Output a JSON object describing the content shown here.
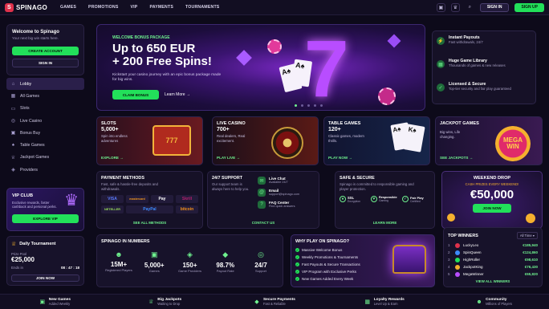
{
  "brand": {
    "name": "SPINAGO"
  },
  "nav": [
    "GAMES",
    "PROMOTIONS",
    "VIP",
    "PAYMENTS",
    "TOURNAMENTS"
  ],
  "topbar": {
    "signin": "SIGN IN",
    "signup": "SIGN UP"
  },
  "welcome": {
    "title": "Welcome to Spinago",
    "subtitle": "Your next big win starts here.",
    "create": "CREATE ACCOUNT",
    "signin": "SIGN IN"
  },
  "menu": [
    "Lobby",
    "All Games",
    "Slots",
    "Live Casino",
    "Bonus Buy",
    "Table Games",
    "Jackpot Games",
    "Providers"
  ],
  "vip": {
    "title": "VIP CLUB",
    "desc": "Exclusive rewards, faster cashback and personal perks.",
    "button": "EXPLORE VIP"
  },
  "tournament": {
    "title": "Daily Tournament",
    "prize_label": "Prize Pool",
    "prize": "€25,000",
    "ends_label": "Ends in",
    "time": "08 : 47 : 18",
    "button": "JOIN NOW"
  },
  "hero": {
    "tag": "WELCOME BONUS PACKAGE",
    "line1": "Up to 650 EUR",
    "line2": "+ 200 Free Spins!",
    "desc": "Kickstart your casino journey with an epic bonus package made for big wins.",
    "claim": "CLAIM BONUS",
    "learn": "Learn More"
  },
  "features": [
    {
      "title": "Instant Payouts",
      "desc": "Fast withdrawals, 24/7"
    },
    {
      "title": "Huge Game Library",
      "desc": "Thousands of games & new releases"
    },
    {
      "title": "Licensed & Secure",
      "desc": "Top-tier security and fair play guaranteed"
    }
  ],
  "categories": [
    {
      "title": "SLOTS",
      "count": "5,000+",
      "desc": "Spin into endless adventures",
      "link": "EXPLORE"
    },
    {
      "title": "LIVE CASINO",
      "count": "700+",
      "desc": "Real dealers, Real excitement.",
      "link": "PLAY LIVE"
    },
    {
      "title": "TABLE GAMES",
      "count": "120+",
      "desc": "Classic games, modern thrills.",
      "link": "PLAY NOW"
    },
    {
      "title": "JACKPOT GAMES",
      "count": "",
      "desc": "Big wins, Life changing.",
      "link": "SEE JACKPOTS",
      "badge1": "MEGA",
      "badge2": "WIN"
    }
  ],
  "payments": {
    "title": "PAYMENT METHODS",
    "desc": "Fast, safe & hassle-free deposits and withdrawals.",
    "methods": [
      "VISA",
      "mastercard",
      "Pay",
      "Skrill",
      "NETELLER",
      "PayPal",
      "bitcoin"
    ],
    "link": "SEE ALL METHODS"
  },
  "support": {
    "title": "24/7 SUPPORT",
    "desc": "Our support team is always here to help you.",
    "items": [
      {
        "t": "Live Chat",
        "s": "Available 24/7"
      },
      {
        "t": "Email",
        "s": "support@spinago.com"
      },
      {
        "t": "FAQ Center",
        "s": "Find quick answers"
      }
    ],
    "link": "CONTACT US"
  },
  "secure": {
    "title": "SAFE & SECURE",
    "desc": "Spinago is committed to responsible gaming and player protection.",
    "badges": [
      {
        "t": "SSL",
        "s": "Encryption"
      },
      {
        "t": "Responsible",
        "s": "Gaming"
      },
      {
        "t": "Fair Play",
        "s": "Certified"
      }
    ],
    "link": "LEARN MORE"
  },
  "drop": {
    "title": "WEEKEND DROP",
    "sub": "CASH PRIZES EVERY WEEKEND!",
    "amount": "€50,000",
    "button": "JOIN NOW"
  },
  "numbers": {
    "title": "SPINAGO IN NUMBERS",
    "items": [
      {
        "v": "15M+",
        "l": "Registered Players"
      },
      {
        "v": "5,000+",
        "l": "Games"
      },
      {
        "v": "150+",
        "l": "Game Providers"
      },
      {
        "v": "98.7%",
        "l": "Payout Rate"
      },
      {
        "v": "24/7",
        "l": "Support"
      }
    ]
  },
  "why": {
    "title": "WHY PLAY ON SPINAGO?",
    "items": [
      "Massive Welcome Bonus",
      "Weekly Promotions & Tournaments",
      "Fast Payouts & Secure Transactions",
      "VIP Program with Exclusive Perks",
      "New Games Added Every Week"
    ]
  },
  "winners": {
    "title": "TOP WINNERS",
    "filter": "All Time",
    "rows": [
      {
        "n": "1",
        "u": "LuckyLeo",
        "a": "€185,940"
      },
      {
        "n": "2",
        "u": "SpinQueen",
        "a": "€124,860"
      },
      {
        "n": "3",
        "u": "HighRoller",
        "a": "€98,610"
      },
      {
        "n": "4",
        "u": "JackpotKing",
        "a": "€76,430"
      },
      {
        "n": "5",
        "u": "MegaWinner",
        "a": "€65,820"
      }
    ],
    "link": "VIEW ALL WINNERS"
  },
  "bottom": [
    {
      "t": "New Games",
      "s": "Added Weekly"
    },
    {
      "t": "Big Jackpots",
      "s": "Waiting to Drop"
    },
    {
      "t": "Secure Payments",
      "s": "Fast & Reliable"
    },
    {
      "t": "Loyalty Rewards",
      "s": "Level Up & Earn"
    },
    {
      "t": "Community",
      "s": "Millions of Players"
    }
  ]
}
